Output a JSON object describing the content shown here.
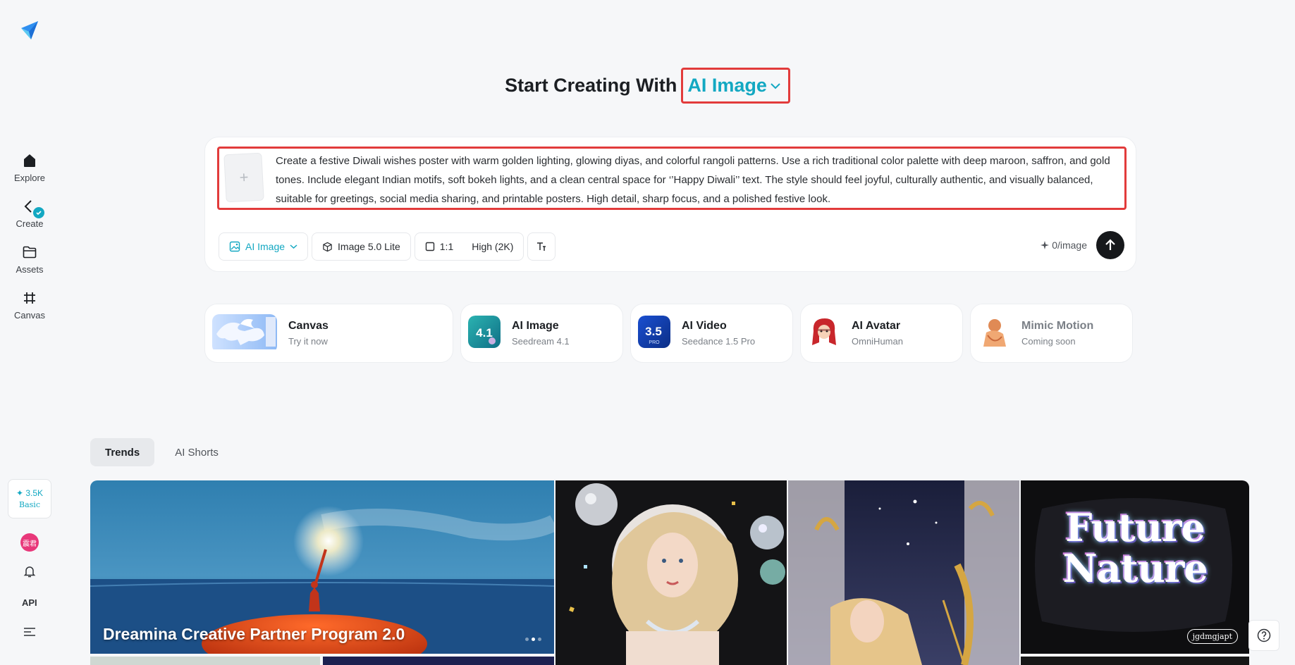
{
  "sidebar": {
    "logo": "dreamina-logo",
    "items": [
      {
        "label": "Explore",
        "icon": "home-icon"
      },
      {
        "label": "Create",
        "icon": "create-icon"
      },
      {
        "label": "Assets",
        "icon": "folder-icon"
      },
      {
        "label": "Canvas",
        "icon": "canvas-icon"
      }
    ],
    "credits": {
      "amount": "✦ 3.5K",
      "tier": "Basic"
    },
    "avatar_text": "震君",
    "api_label": "API"
  },
  "header": {
    "prefix": "Start Creating With",
    "mode": "AI Image"
  },
  "prompt": {
    "text": "Create a festive Diwali wishes poster with warm golden lighting, glowing diyas, and colorful rangoli patterns. Use a rich traditional color palette with deep maroon, saffron, and gold tones. Include elegant Indian motifs, soft bokeh lights, and a clean central space for ‘’Happy Diwali’’ text. The style should feel joyful, culturally authentic, and visually balanced, suitable for greetings, social media sharing, and printable posters. High detail, sharp focus, and a polished festive look.",
    "upload_glyph": "+"
  },
  "toolbar": {
    "mode_label": "AI Image",
    "model_label": "Image 5.0 Lite",
    "ratio_label": "1:1",
    "quality_label": "High (2K)",
    "cost_label": "0/image"
  },
  "features": [
    {
      "title": "Canvas",
      "sub": "Try it now"
    },
    {
      "title": "AI Image",
      "sub": "Seedream 4.1",
      "badge": "4.1"
    },
    {
      "title": "AI Video",
      "sub": "Seedance 1.5 Pro",
      "badge": "3.5",
      "badge_sub": "PRO"
    },
    {
      "title": "AI Avatar",
      "sub": "OmniHuman"
    },
    {
      "title": "Mimic Motion",
      "sub": "Coming soon"
    }
  ],
  "tabs": [
    {
      "label": "Trends",
      "active": true
    },
    {
      "label": "AI Shorts",
      "active": false
    }
  ],
  "gallery": {
    "hero_caption": "Dreamina Creative Partner Program 2.0",
    "future_nature": "Future Nature",
    "signature": "jgdmgjapt"
  },
  "colors": {
    "accent": "#13a8c2",
    "highlight": "#e23b3b",
    "background": "#f6f7f9"
  }
}
